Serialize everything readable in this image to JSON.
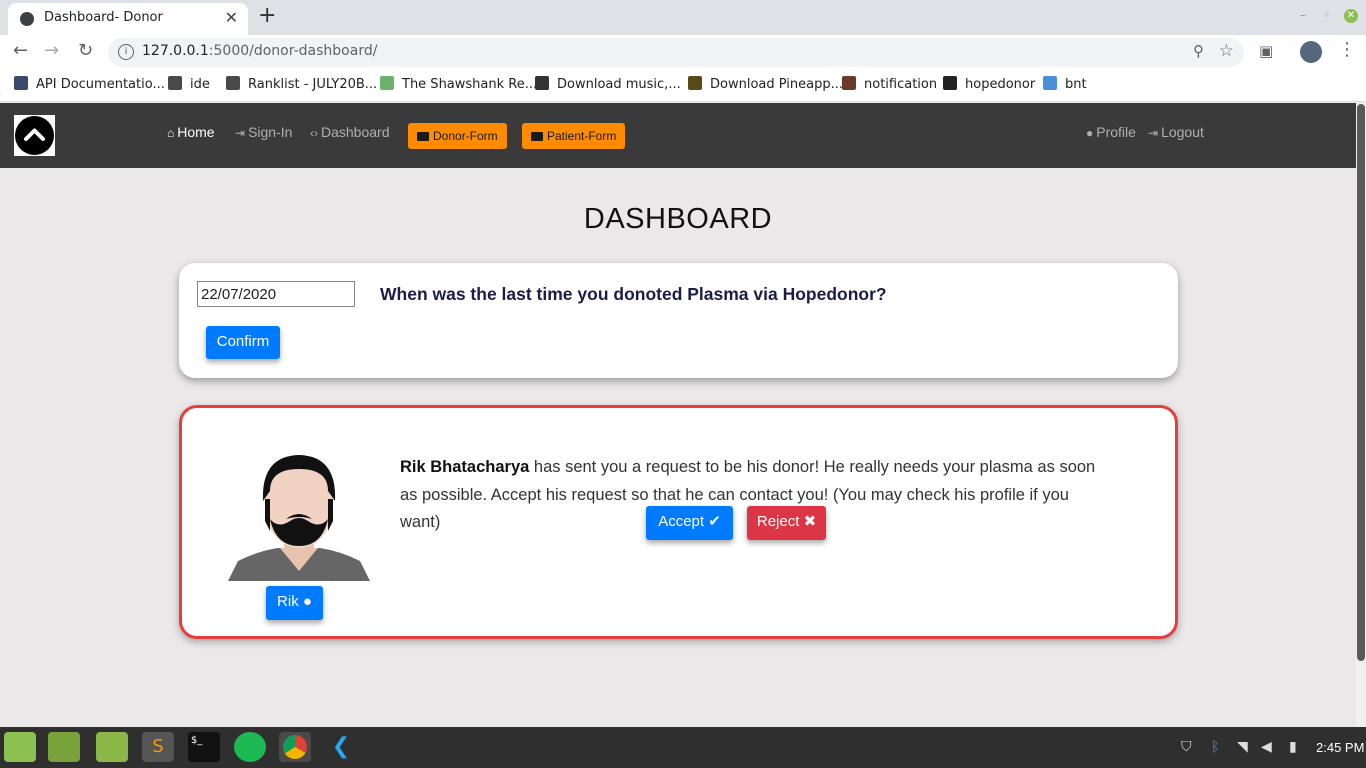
{
  "browser": {
    "tab_title": "Dashboard- Donor",
    "tab_close": "✕",
    "new_tab": "+",
    "url_host": "127.0.0.1",
    "url_path": ":5000/donor-dashboard/",
    "bookmarks": [
      {
        "label": "API Documentatio...",
        "color": "#3b4a6b"
      },
      {
        "label": "ide",
        "color": "#4a4a4a"
      },
      {
        "label": "Ranklist - JULY20B...",
        "color": "#4a4a4a"
      },
      {
        "label": "The Shawshank Re...",
        "color": "#6bb36b"
      },
      {
        "label": "Download music,...",
        "color": "#333333"
      },
      {
        "label": "Download Pineapp...",
        "color": "#5a4a1a"
      },
      {
        "label": "notification",
        "color": "#6b3a2a"
      },
      {
        "label": "hopedonor",
        "color": "#222222"
      },
      {
        "label": "bnt",
        "color": "#4a90d9"
      }
    ]
  },
  "navbar": {
    "home": "Home",
    "signin": "Sign-In",
    "dashboard": "Dashboard",
    "donor_form": "Donor-Form",
    "patient_form": "Patient-Form",
    "profile": "Profile",
    "logout": "Logout"
  },
  "page": {
    "title": "DASHBOARD",
    "last_donation": {
      "date_value": "22/07/2020",
      "question": "When was the last time you donoted Plasma via Hopedonor?",
      "confirm_label": "Confirm"
    },
    "request": {
      "requester_name": "Rik Bhatacharya",
      "message": " has sent you a request to be his donor! He really needs your plasma as soon as possible. Accept his request so that he can contact you! (You may check his profile if you want)",
      "accept_label": "Accept",
      "reject_label": "Reject",
      "profile_button_label": "Rik"
    }
  },
  "taskbar": {
    "clock": "2:45 PM"
  },
  "colors": {
    "navbar_bg": "#3a3a3a",
    "orange": "#ff8c00",
    "primary": "#007bff",
    "danger": "#dc3545",
    "alert_border": "#e53e3e"
  }
}
